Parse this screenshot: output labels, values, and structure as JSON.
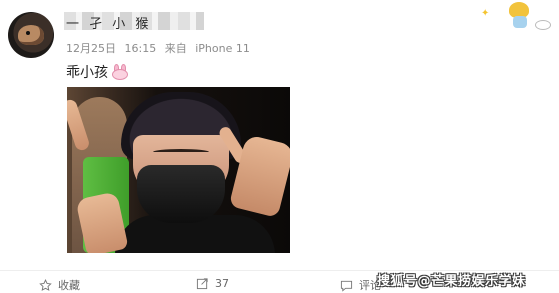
{
  "post": {
    "username": "一 孑 小 猴",
    "date": "12月25日",
    "time": "16:15",
    "source_prefix": "来自",
    "source": "iPhone 11",
    "text": "乖小孩"
  },
  "actions": {
    "favorite_label": "收藏",
    "repost_count": "37",
    "comment_label": "评论"
  },
  "watermark": "搜狐号@芒果捞娱乐学妹",
  "icons": [
    "bunny-emoji-icon",
    "star-bookmark-icon",
    "repost-icon",
    "comment-icon"
  ]
}
